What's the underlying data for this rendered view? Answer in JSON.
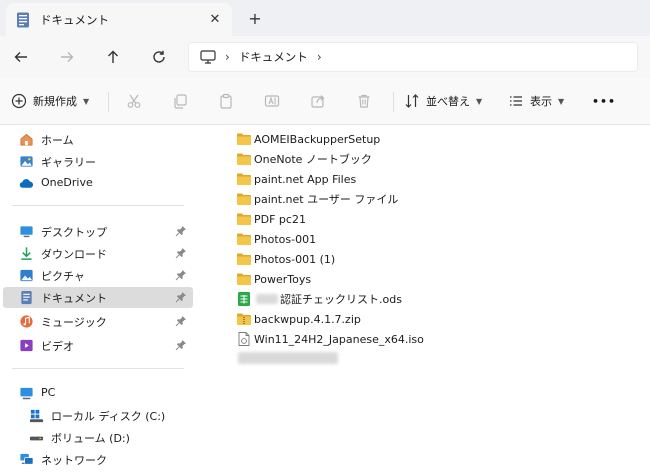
{
  "window": {
    "tab_title": "ドキュメント",
    "tab_close": "✕",
    "new_tab": "+"
  },
  "address": {
    "crumb_sep": "›",
    "crumb": "ドキュメント",
    "crumb_trail": "›"
  },
  "commands": {
    "new_label": "新規作成",
    "sort_label": "並べ替え",
    "view_label": "表示",
    "more_label": "•••"
  },
  "sidebar": {
    "quick": [
      {
        "label": "ホーム",
        "icon": "home-icon"
      },
      {
        "label": "ギャラリー",
        "icon": "gallery-icon"
      },
      {
        "label": "OneDrive",
        "icon": "onedrive-icon"
      }
    ],
    "pinned": [
      {
        "label": "デスクトップ",
        "icon": "desktop-icon"
      },
      {
        "label": "ダウンロード",
        "icon": "download-icon"
      },
      {
        "label": "ピクチャ",
        "icon": "pictures-icon"
      },
      {
        "label": "ドキュメント",
        "icon": "documents-icon",
        "selected": true
      },
      {
        "label": "ミュージック",
        "icon": "music-icon"
      },
      {
        "label": "ビデオ",
        "icon": "videos-icon"
      }
    ],
    "this_pc": {
      "label": "PC",
      "icon": "pc-icon"
    },
    "drives": [
      {
        "label": "ローカル ディスク (C:)",
        "icon": "windows-drive-icon"
      },
      {
        "label": "ボリューム (D:)",
        "icon": "drive-icon"
      }
    ],
    "network": {
      "label": "ネットワーク",
      "icon": "network-icon"
    }
  },
  "files": [
    {
      "name": "AOMEIBackupperSetup",
      "type": "folder"
    },
    {
      "name": "OneNote ノートブック",
      "type": "folder"
    },
    {
      "name": "paint.net App Files",
      "type": "folder"
    },
    {
      "name": "paint.net ユーザー ファイル",
      "type": "folder"
    },
    {
      "name": "PDF pc21",
      "type": "folder"
    },
    {
      "name": "Photos-001",
      "type": "folder"
    },
    {
      "name": "Photos-001 (1)",
      "type": "folder"
    },
    {
      "name": "PowerToys",
      "type": "folder"
    },
    {
      "name": "認証チェックリスト.ods",
      "type": "ods"
    },
    {
      "name": "backwpup.4.1.7.zip",
      "type": "zip"
    },
    {
      "name": "Win11_24H2_Japanese_x64.iso",
      "type": "iso"
    }
  ],
  "colors": {
    "folder": "#f3c64a",
    "folder_dark": "#e0a82a",
    "accent": "#0067c0",
    "selected_bg": "#dcdcdc"
  }
}
